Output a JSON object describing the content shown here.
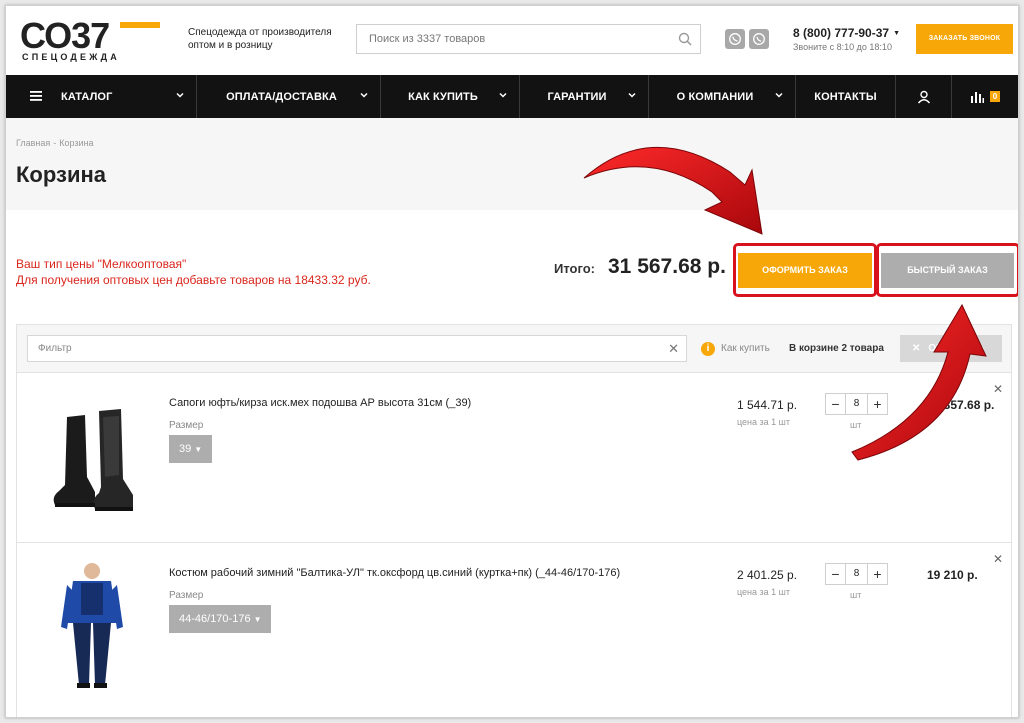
{
  "header": {
    "logo_text": "СО37",
    "logo_sub": "СПЕЦОДЕЖДА",
    "tagline": "Спецодежда от производителя оптом и в розницу",
    "search_placeholder": "Поиск из 3337 товаров",
    "phone": "8 (800) 777-90-37",
    "hours": "Звоните с 8:10 до 18:10",
    "callback_label": "ЗАКАЗАТЬ ЗВОНОК"
  },
  "nav": {
    "items": [
      {
        "label": "КАТАЛОГ"
      },
      {
        "label": "ОПЛАТА/ДОСТАВКА"
      },
      {
        "label": "КАК КУПИТЬ"
      },
      {
        "label": "ГАРАНТИИ"
      },
      {
        "label": "О КОМПАНИИ"
      },
      {
        "label": "КОНТАКТЫ"
      }
    ],
    "compare_count": "0"
  },
  "breadcrumbs": {
    "home": "Главная",
    "separator": "-",
    "current": "Корзина"
  },
  "page_title": "Корзина",
  "notice": {
    "line1": "Ваш тип цены \"Мелкооптовая\"",
    "line2": "Для получения оптовых цен добавьте товаров на 18433.32 руб."
  },
  "summary": {
    "total_label": "Итого:",
    "total_value": "31 567.68 р.",
    "order_button": "ОФОРМИТЬ ЗАКАЗ",
    "quick_button": "БЫСТРЫЙ ЗАКАЗ"
  },
  "cart": {
    "filter_placeholder": "Фильтр",
    "how_to_buy": "Как купить",
    "in_cart": "В корзине 2 товара",
    "clear_button": "ОЧИСТИТЬ",
    "items": [
      {
        "name": "Сапоги юфть/кирза иск.мех подошва АР высота 31см (_39)",
        "size_label": "Размер",
        "size_value": "39",
        "price": "1 544.71 р.",
        "price_note": "цена за 1 шт",
        "qty": "8",
        "unit": "шт",
        "sum": "12 357.68 р."
      },
      {
        "name": "Костюм рабочий зимний \"Балтика-УЛ\" тк.оксфорд цв.синий (куртка+пк) (_44-46/170-176)",
        "size_label": "Размер",
        "size_value": "44-46/170-176",
        "price": "2 401.25 р.",
        "price_note": "цена за 1 шт",
        "qty": "8",
        "unit": "шт",
        "sum": "19 210 р."
      }
    ]
  },
  "colors": {
    "accent": "#f7a707",
    "nav_bg": "#121212",
    "notice": "#d9261c",
    "highlight": "#d8121c",
    "disabled_button": "#adadad"
  }
}
